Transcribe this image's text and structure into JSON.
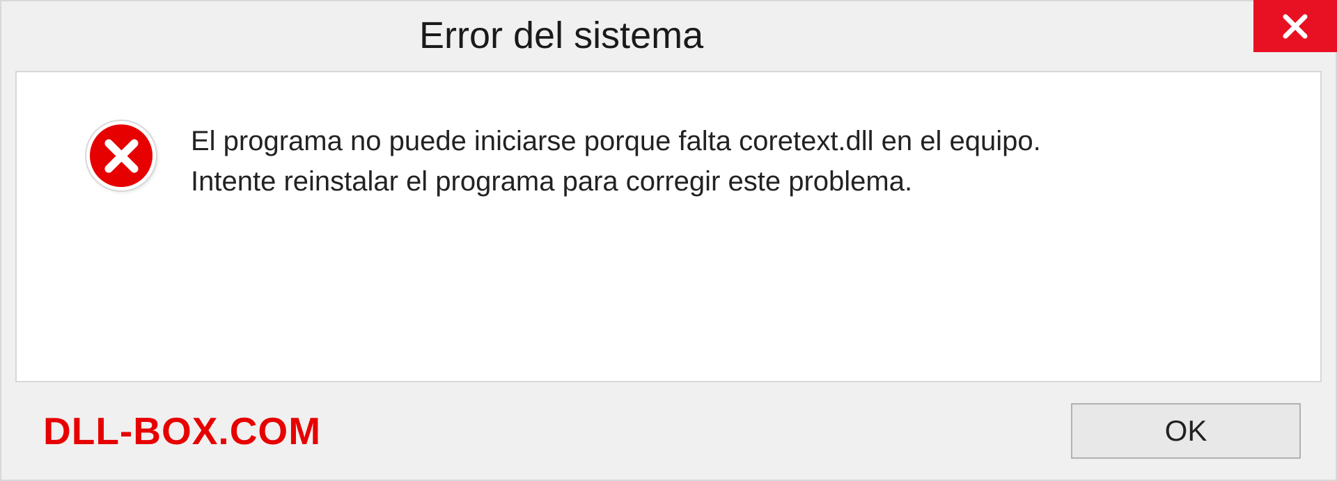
{
  "titlebar": {
    "title": "Error del sistema"
  },
  "message": {
    "line1": "El programa no puede iniciarse porque falta coretext.dll en el equipo.",
    "line2": "Intente reinstalar el programa para corregir este problema."
  },
  "footer": {
    "watermark": "DLL-BOX.COM",
    "ok_label": "OK"
  },
  "colors": {
    "error_red": "#e60000",
    "close_red": "#e81123"
  }
}
